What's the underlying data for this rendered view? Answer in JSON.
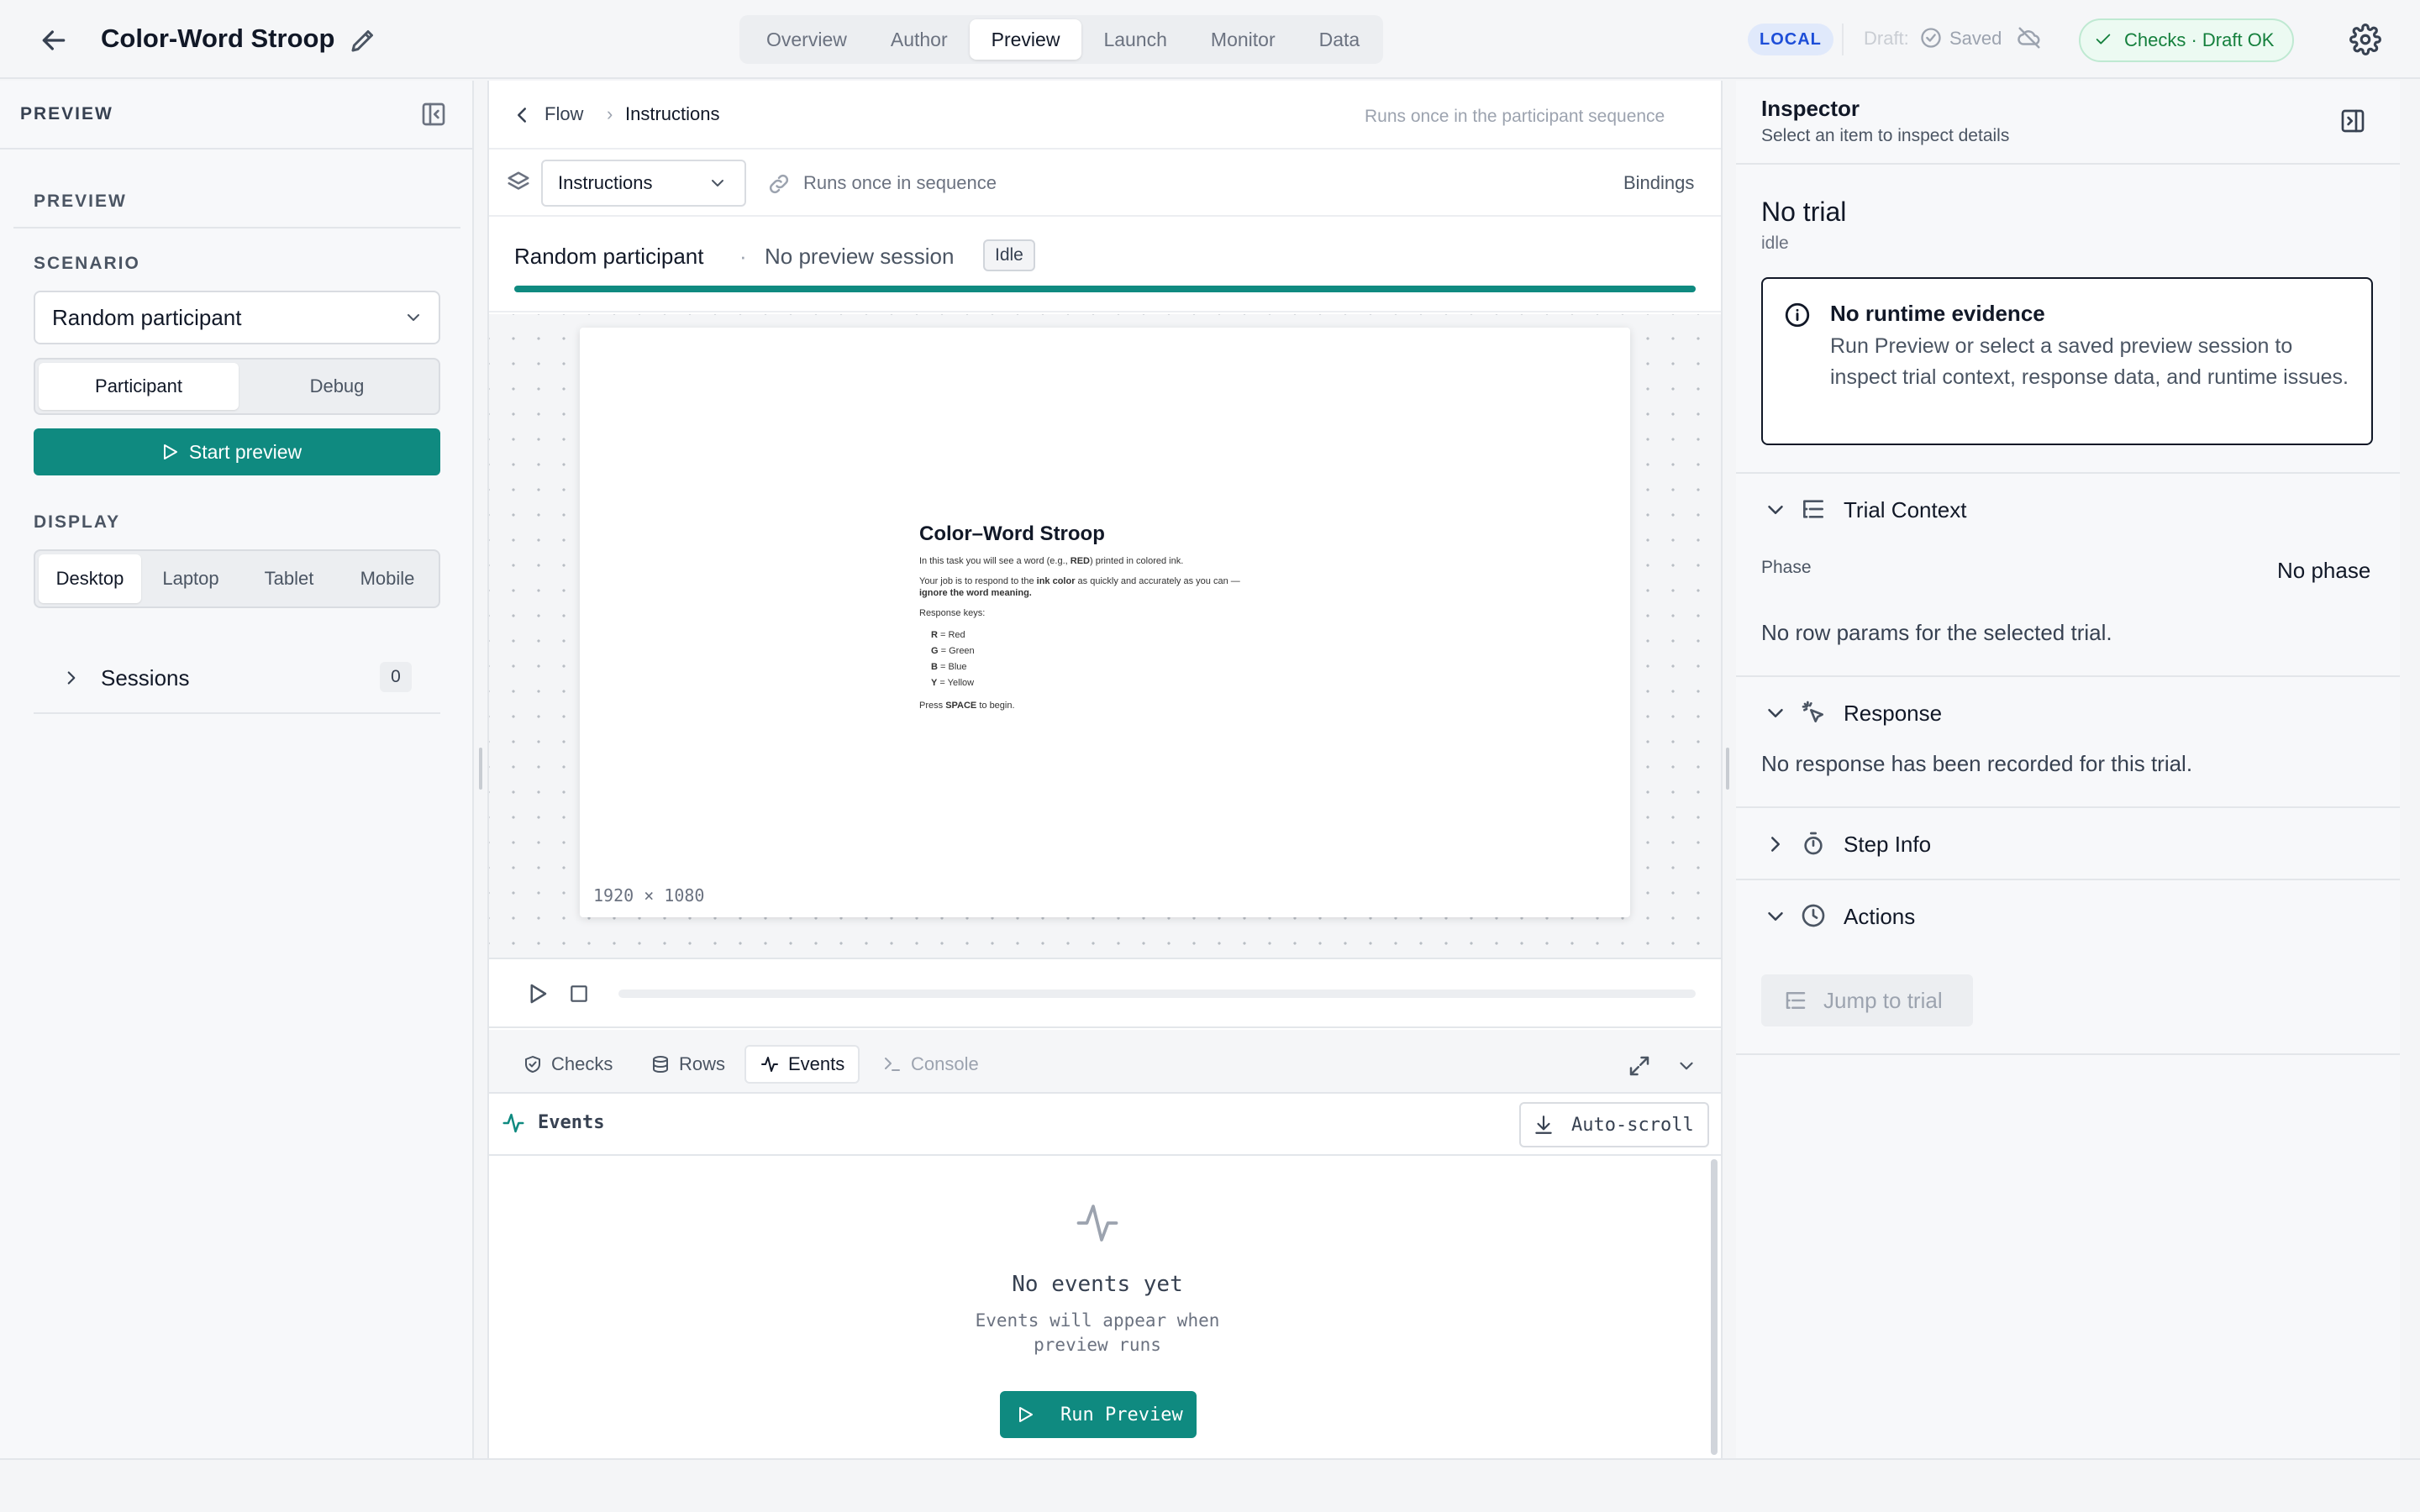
{
  "header": {
    "title": "Color-Word Stroop",
    "tabs": [
      "Overview",
      "Author",
      "Preview",
      "Launch",
      "Monitor",
      "Data"
    ],
    "active_tab": "Preview",
    "env_badge": "LOCAL",
    "draft_label": "Draft:",
    "saved_label": "Saved",
    "checks_label": "Checks · Draft OK"
  },
  "sidebar": {
    "title": "PREVIEW",
    "section_label": "PREVIEW",
    "scenario_label": "SCENARIO",
    "scenario_value": "Random participant",
    "modes": [
      "Participant",
      "Debug"
    ],
    "active_mode": "Participant",
    "start_label": "Start preview",
    "display_label": "DISPLAY",
    "displays": [
      "Desktop",
      "Laptop",
      "Tablet",
      "Mobile"
    ],
    "active_display": "Desktop",
    "sessions_label": "Sessions",
    "sessions_count": "0"
  },
  "center": {
    "breadcrumb": {
      "back": "Flow",
      "sep": "›",
      "current": "Instructions"
    },
    "breadcrumb_meta": "Runs once in the participant sequence",
    "step_select": "Instructions",
    "step_meta": "Runs once in sequence",
    "bindings_label": "Bindings",
    "participant": "Random participant",
    "dot": "·",
    "session": "No preview session",
    "status": "Idle",
    "progress": 1.0,
    "stage": {
      "title": "Color–Word Stroop",
      "line1_a": "In this task you will see a word (e.g., ",
      "line1_b": "RED",
      "line1_c": ") printed in colored ink.",
      "line2_a": "Your job is to respond to the ",
      "line2_b": "ink color",
      "line2_c": " as quickly and accurately as you can —",
      "line3": "ignore the word meaning.",
      "keys_label": "Response keys:",
      "keys": [
        {
          "key": "R",
          "text": " = Red"
        },
        {
          "key": "G",
          "text": " = Green"
        },
        {
          "key": "B",
          "text": " = Blue"
        },
        {
          "key": "Y",
          "text": " = Yellow"
        }
      ],
      "press_a": "Press ",
      "press_b": "SPACE",
      "press_c": " to begin.",
      "dimensions": "1920 × 1080"
    },
    "bottom_tabs": [
      "Checks",
      "Rows",
      "Events",
      "Console"
    ],
    "active_bottom_tab": "Events",
    "events_title": "Events",
    "autoscroll_label": "Auto-scroll",
    "empty_title": "No events yet",
    "empty_sub_1": "Events will appear when",
    "empty_sub_2": "preview runs",
    "run_label": "Run Preview"
  },
  "inspector": {
    "title": "Inspector",
    "subtitle": "Select an item to inspect details",
    "trial_title": "No trial",
    "trial_state": "idle",
    "evidence_title": "No runtime evidence",
    "evidence_body": "Run Preview or select a saved preview session to inspect trial context, response data, and runtime issues.",
    "sections": {
      "trial_context": "Trial Context",
      "response": "Response",
      "step_info": "Step Info",
      "actions": "Actions"
    },
    "phase_label": "Phase",
    "phase_value": "No phase",
    "no_row_params": "No row params for the selected trial.",
    "no_response": "No response has been recorded for this trial.",
    "jump_label": "Jump to trial"
  },
  "colors": {
    "accent": "#0f8a80",
    "success": "#15803d",
    "local_badge": "#1d4ed8"
  }
}
